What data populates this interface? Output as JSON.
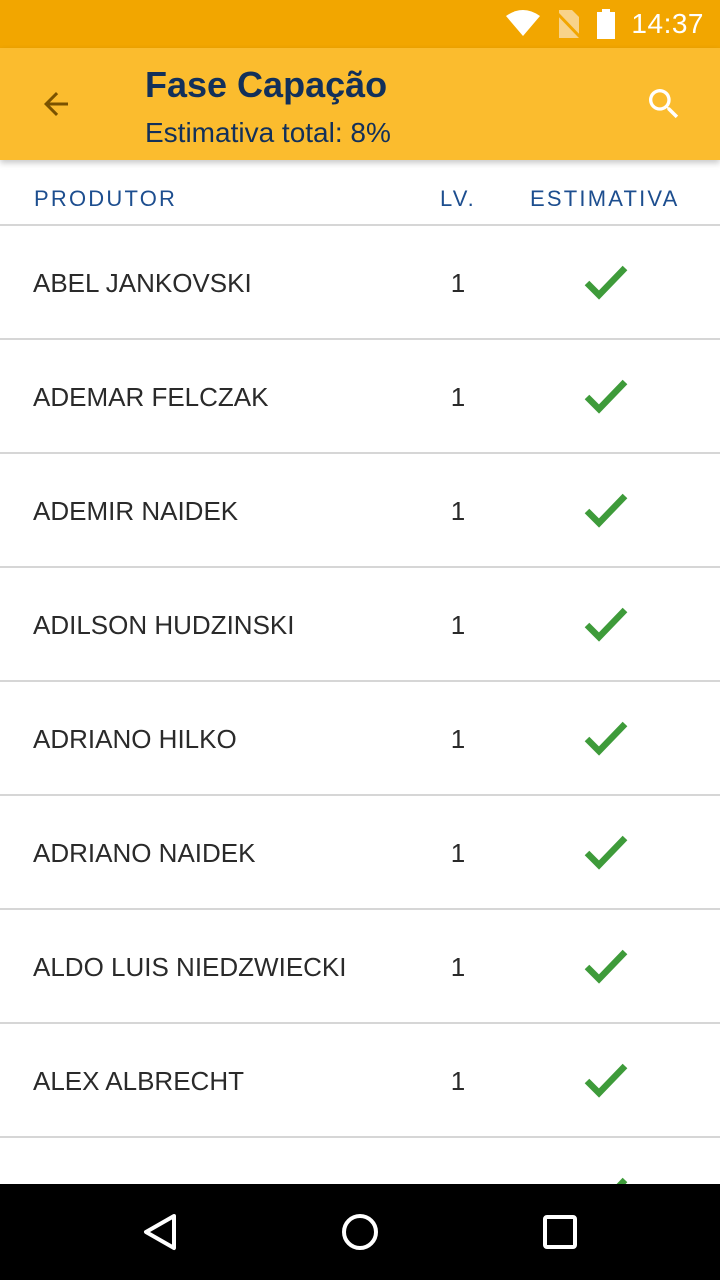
{
  "status_bar": {
    "time": "14:37",
    "icons": [
      "wifi-icon",
      "no-sim-icon",
      "battery-icon"
    ]
  },
  "app_bar": {
    "title": "Fase Capação",
    "subtitle": "Estimativa total: 8%",
    "back_icon": "arrow-left-icon",
    "search_icon": "search-icon"
  },
  "table": {
    "headers": {
      "produtor": "PRODUTOR",
      "lv": "LV.",
      "estimativa": "ESTIMATIVA"
    },
    "rows": [
      {
        "produtor": "ABEL JANKOVSKI",
        "lv": "1",
        "estimativa": "check-icon"
      },
      {
        "produtor": "ADEMAR FELCZAK",
        "lv": "1",
        "estimativa": "check-icon"
      },
      {
        "produtor": "ADEMIR NAIDEK",
        "lv": "1",
        "estimativa": "check-icon"
      },
      {
        "produtor": "ADILSON HUDZINSKI",
        "lv": "1",
        "estimativa": "check-icon"
      },
      {
        "produtor": "ADRIANO HILKO",
        "lv": "1",
        "estimativa": "check-icon"
      },
      {
        "produtor": "ADRIANO NAIDEK",
        "lv": "1",
        "estimativa": "check-icon"
      },
      {
        "produtor": "ALDO LUIS NIEDZWIECKI",
        "lv": "1",
        "estimativa": "check-icon"
      },
      {
        "produtor": "ALEX ALBRECHT",
        "lv": "1",
        "estimativa": "check-icon"
      }
    ]
  },
  "colors": {
    "status_bar": "#f2a600",
    "app_bar": "#fbbc2e",
    "title_text": "#12305a",
    "header_text": "#1d4e8f",
    "check": "#3e9b3a",
    "divider": "#d6d6d6"
  },
  "nav_bar": {
    "icons": [
      "nav-back-icon",
      "nav-home-icon",
      "nav-recents-icon"
    ]
  }
}
